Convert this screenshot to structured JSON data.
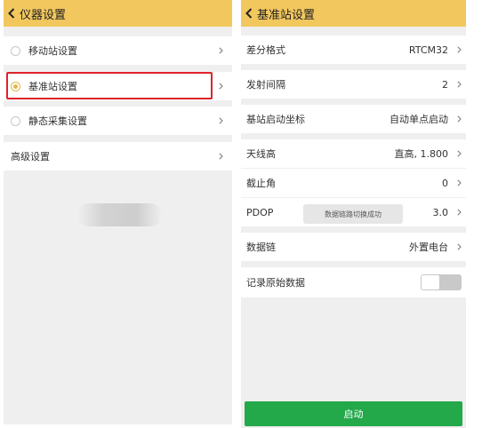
{
  "left_screen": {
    "title": "仪器设置",
    "options": [
      {
        "label": "移动站设置",
        "selected": false
      },
      {
        "label": "基准站设置",
        "selected": true
      },
      {
        "label": "静态采集设置",
        "selected": false
      }
    ],
    "advanced_label": "高级设置",
    "highlight_color": "#e0222a"
  },
  "right_screen": {
    "title": "基准站设置",
    "settings": [
      {
        "label": "差分格式",
        "value": "RTCM32"
      },
      {
        "label": "发射间隔",
        "value": "2"
      },
      {
        "label": "基站启动坐标",
        "value": "自动单点启动"
      },
      {
        "label": "天线高",
        "value": "直高, 1.800"
      },
      {
        "label": "截止角",
        "value": "0"
      },
      {
        "label": "PDOP",
        "value": "3.0"
      },
      {
        "label": "数据链",
        "value": "外置电台"
      }
    ],
    "record_raw_label": "记录原始数据",
    "record_raw_on": false,
    "toast": "数据链路切换成功",
    "start_label": "启动"
  },
  "colors": {
    "topbar": "#f2c75e",
    "accent_radio": "#e3b74c",
    "start_button": "#23a84a",
    "background": "#efefef"
  }
}
